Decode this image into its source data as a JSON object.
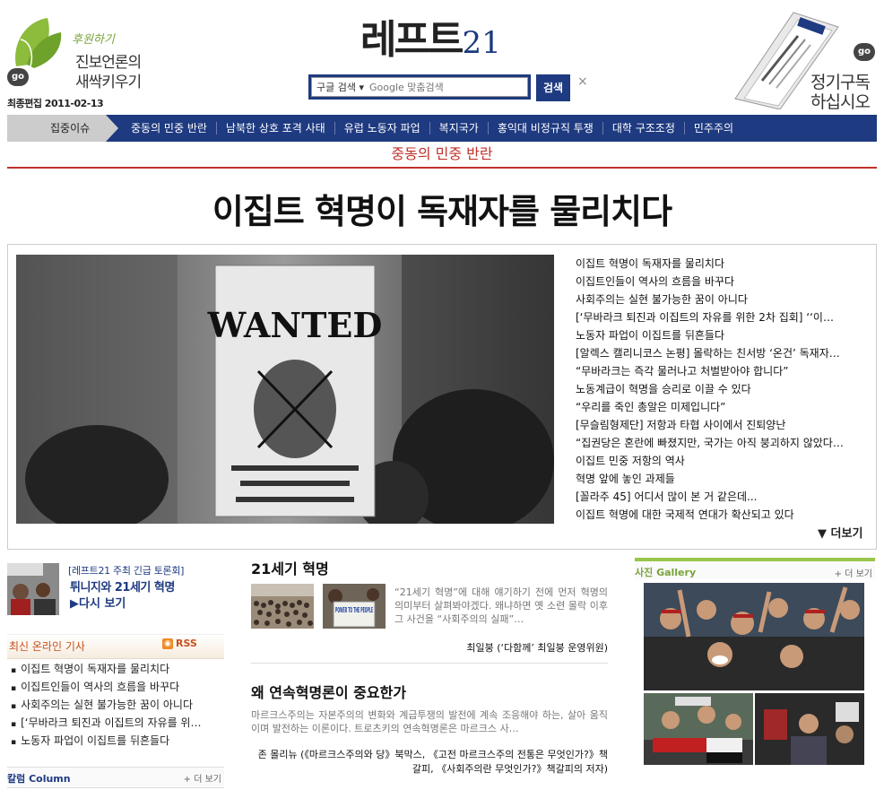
{
  "header": {
    "support_tagline": "후원하기",
    "support_line1": "진보언론의",
    "support_line2": "새싹키우기",
    "go_label": "go",
    "updated": "최종편집 2011-02-13",
    "logo_korean": "레프트",
    "logo_number": "21",
    "search_engine": "구글 검색",
    "search_placeholder": "Google 맞춤검색",
    "search_button": "검색",
    "close_symbol": "×",
    "subscribe_line1": "정기구독",
    "subscribe_line2": "하십시오"
  },
  "nav": {
    "focus_label": "집중이슈",
    "items": [
      "중동의 민중 반란",
      "남북한 상호 포격 사태",
      "유럽 노동자 파업",
      "복지국가",
      "홍익대 비정규직 투쟁",
      "대학 구조조정",
      "민주주의"
    ]
  },
  "topic_title": "중동의 민중 반란",
  "headline": "이집트 혁명이 독재자를 물리치다",
  "feature": {
    "image_sign_text": "WANTED",
    "links": [
      "이집트 혁명이 독재자를 물리치다",
      "이집트인들이 역사의 흐름을 바꾸다",
      "사회주의는 실현 불가능한 꿈이 아니다",
      "[‘무바라크 퇴진과 이집트의 자유를 위한 2차 집회] ‘‘이…",
      "노동자 파업이 이집트를 뒤흔들다",
      "[알렉스 캘리니코스 논평] 몰락하는 친서방 ‘온건’ 독재자…",
      "“무바라크는 즉각 물러나고 처벌받아야 합니다”",
      "노동계급이 혁명을 승리로 이끌 수 있다",
      "“우리를 죽인 총알은 미제입니다”",
      "[무슬림형제단] 저항과 타협 사이에서 진퇴양난",
      "“집권당은 혼란에 빠졌지만, 국가는 아직 붕괴하지 않았다…",
      "이집트 민중 저항의 역사",
      "혁명 앞에 놓인 과제들",
      "[꼴라주 45] 어디서 많이 본 거 같은데...",
      "이집트 혁명에 대한 국제적 연대가 확산되고 있다"
    ],
    "more_label": "▼ 더보기"
  },
  "left": {
    "promo_line1": "[레프트21 주최 긴급 토론회]",
    "promo_line2": "튀니지와 21세기 혁명",
    "promo_line3": "▶다시 보기",
    "online_title": "최신 온라인 기사",
    "rss_icon": "rss-icon",
    "rss_label": "RSS",
    "online_items": [
      "이집트 혁명이 독재자를 물리치다",
      "이집트인들이 역사의 흐름을 바꾸다",
      "사회주의는 실현 불가능한 꿈이 아니다",
      "[‘무바라크 퇴진과 이집트의 자유를 위…",
      "노동자 파업이 이집트를 뒤흔들다"
    ],
    "column_title": "칼럼 Column",
    "column_more": "+ 더 보기"
  },
  "middle": {
    "article1": {
      "title": "21세기 혁명",
      "body": "“21세기 혁명”에 대해 얘기하기 전에 먼저 혁명의 의미부터 살펴봐야겠다. 왜냐하면 옛 소련 몰락 이후 그 사건을 “사회주의의 실패”…",
      "author": "최일붕 (‘다함께’ 최일붕 운영위원)",
      "sign_text": "POWER TO THE PEOPLE"
    },
    "article2": {
      "title": "왜 연속혁명론이 중요한가",
      "body": "마르크스주의는 자본주의의 변화와 계급투쟁의 발전에 계속 조응해야 하는, 살아 움직이며 발전하는 이론이다. 트로츠키의 연속혁명론은 마르크스 사…",
      "author_line1": "존 몰리뉴 (《마르크스주의와 당》북막스, 《고전 마르크스주의 전통은 무엇인가?》책",
      "author_line2": "갈피, 《사회주의란 무엇인가?》책갈피의 저자)"
    }
  },
  "right": {
    "gallery_title": "사진 Gallery",
    "gallery_more": "+ 더 보기"
  },
  "colors": {
    "brand_navy": "#1e3a80",
    "accent_red": "#c0302a",
    "gallery_green": "#98c54a",
    "rss_orange": "#f08a24"
  }
}
